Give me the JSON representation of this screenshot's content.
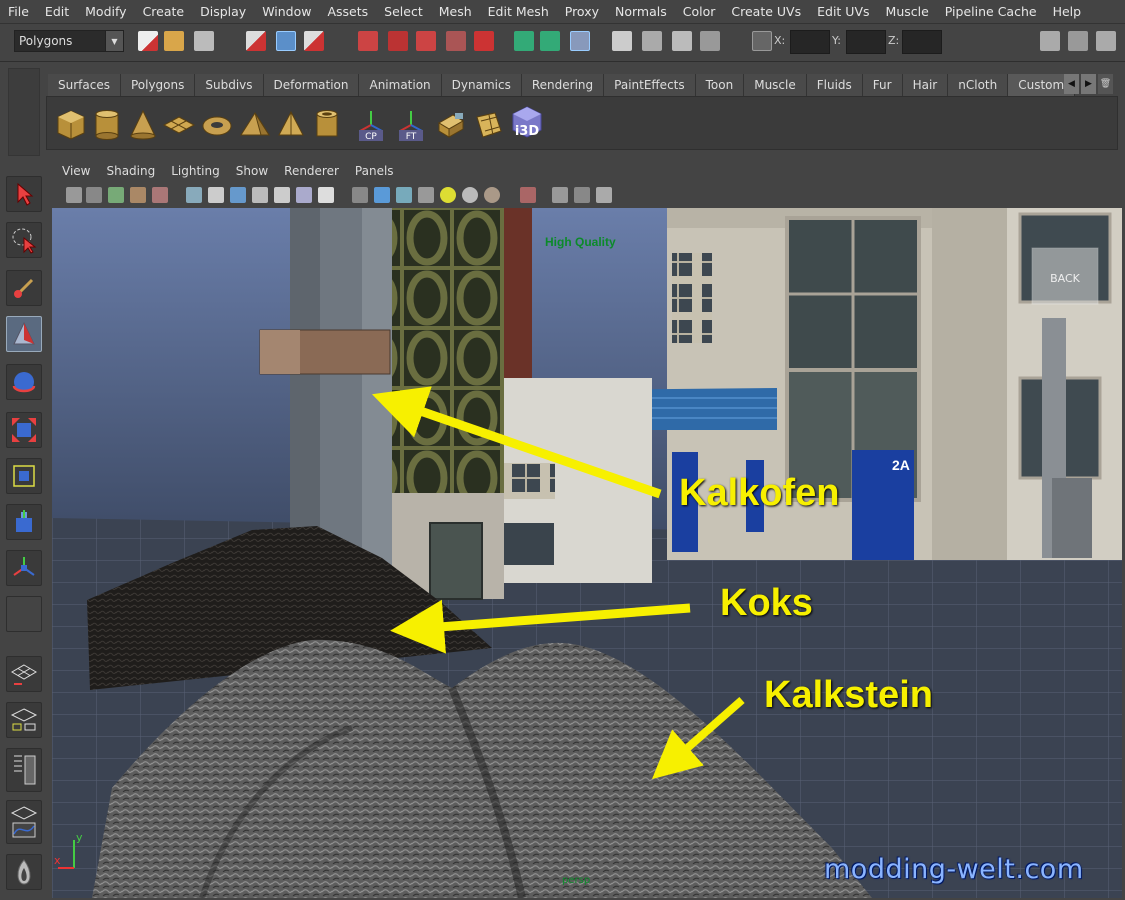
{
  "menubar": {
    "items": [
      "File",
      "Edit",
      "Modify",
      "Create",
      "Display",
      "Window",
      "Assets",
      "Select",
      "Mesh",
      "Edit Mesh",
      "Proxy",
      "Normals",
      "Color",
      "Create UVs",
      "Edit UVs",
      "Muscle",
      "Pipeline Cache",
      "Help"
    ]
  },
  "statusline": {
    "mode": "Polygons",
    "coord_labels": [
      "X:",
      "Y:",
      "Z:"
    ]
  },
  "shelf": {
    "tabs": [
      "Surfaces",
      "Polygons",
      "Subdivs",
      "Deformation",
      "Animation",
      "Dynamics",
      "Rendering",
      "PaintEffects",
      "Toon",
      "Muscle",
      "Fluids",
      "Fur",
      "Hair",
      "nCloth",
      "Custom"
    ],
    "active_tab": "Custom",
    "buttons": [
      {
        "name": "cube-icon",
        "label": ""
      },
      {
        "name": "cylinder-icon",
        "label": ""
      },
      {
        "name": "cone-icon",
        "label": ""
      },
      {
        "name": "plane-icon",
        "label": ""
      },
      {
        "name": "torus-icon",
        "label": ""
      },
      {
        "name": "prism-icon",
        "label": ""
      },
      {
        "name": "pyramid-icon",
        "label": ""
      },
      {
        "name": "pipe-icon",
        "label": ""
      },
      {
        "name": "center-pivot-icon",
        "label": "CP"
      },
      {
        "name": "freeze-transform-icon",
        "label": "FT"
      },
      {
        "name": "uv-map-icon",
        "label": ""
      },
      {
        "name": "uv-editor-icon",
        "label": ""
      },
      {
        "name": "i3d-export-icon",
        "label": "i3D"
      }
    ]
  },
  "viewport": {
    "menu": [
      "View",
      "Shading",
      "Lighting",
      "Show",
      "Renderer",
      "Panels"
    ],
    "hq_label": "High Quality",
    "cube_label": "BACK",
    "door_label": "2A",
    "axis_x": "x",
    "axis_y": "y",
    "persp_label": "persp"
  },
  "annotations": {
    "kalkofen": "Kalkofen",
    "koks": "Koks",
    "kalkstein": "Kalkstein",
    "arrow_color": "#f7f000"
  },
  "watermark": "modding-welt.com",
  "colors": {
    "ui_bg": "#444444",
    "annotation": "#f7f000",
    "hq_text": "#0c8a2a",
    "watermark": "#8ab4ff"
  }
}
